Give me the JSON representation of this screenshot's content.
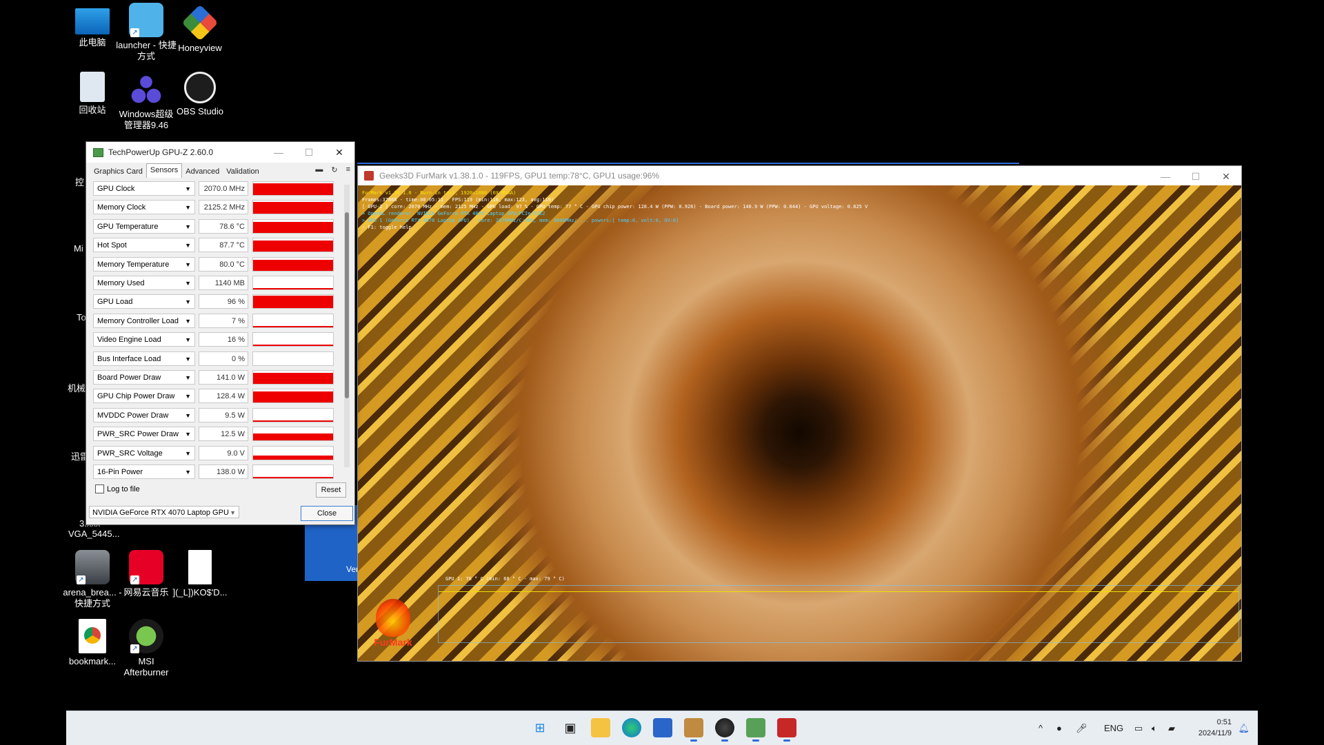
{
  "desktop": {
    "icons": [
      {
        "label": "此电脑"
      },
      {
        "label": "launcher - 快捷方式"
      },
      {
        "label": "Honeyview"
      },
      {
        "label": "回收站"
      },
      {
        "label": "Windows超级管理器9.46"
      },
      {
        "label": "OBS Studio"
      },
      {
        "label": "arena_brea... - 快捷方式"
      },
      {
        "label": "网易云音乐"
      },
      {
        "label": "](_L])KO$'D..."
      },
      {
        "label": "bookmark..."
      },
      {
        "label": "MSI Afterburner"
      }
    ],
    "partial_labels": [
      "控",
      "Mi",
      "To",
      "机械",
      "迅雷",
      "3.xxx",
      "VGA_5445...",
      "Ver"
    ]
  },
  "gpuz": {
    "title": "TechPowerUp GPU-Z 2.60.0",
    "tabs": [
      "Graphics Card",
      "Sensors",
      "Advanced",
      "Validation"
    ],
    "active_tab": "Sensors",
    "sensors": [
      {
        "name": "GPU Clock",
        "value": "2070.0 MHz",
        "level": 0.9
      },
      {
        "name": "Memory Clock",
        "value": "2125.2 MHz",
        "level": 0.9
      },
      {
        "name": "GPU Temperature",
        "value": "78.6 °C",
        "level": 0.85
      },
      {
        "name": "Hot Spot",
        "value": "87.7 °C",
        "level": 0.85
      },
      {
        "name": "Memory Temperature",
        "value": "80.0 °C",
        "level": 0.85
      },
      {
        "name": "Memory Used",
        "value": "1140 MB",
        "level": 0.1
      },
      {
        "name": "GPU Load",
        "value": "96 %",
        "level": 0.96
      },
      {
        "name": "Memory Controller Load",
        "value": "7 %",
        "level": 0.07
      },
      {
        "name": "Video Engine Load",
        "value": "16 %",
        "level": 0.1
      },
      {
        "name": "Bus Interface Load",
        "value": "0 %",
        "level": 0.0
      },
      {
        "name": "Board Power Draw",
        "value": "141.0 W",
        "level": 0.85
      },
      {
        "name": "GPU Chip Power Draw",
        "value": "128.4 W",
        "level": 0.85
      },
      {
        "name": "MVDDC Power Draw",
        "value": "9.5 W",
        "level": 0.1
      },
      {
        "name": "PWR_SRC Power Draw",
        "value": "12.5 W",
        "level": 0.5
      },
      {
        "name": "PWR_SRC Voltage",
        "value": "9.0 V",
        "level": 0.3
      },
      {
        "name": "16-Pin Power",
        "value": "138.0 W",
        "level": 0.1
      }
    ],
    "log_to_file": "Log to file",
    "reset": "Reset",
    "gpu_select": "NVIDIA GeForce RTX 4070 Laptop GPU",
    "close": "Close"
  },
  "furmark": {
    "title": "Geeks3D FurMark v1.38.1.0 - 119FPS, GPU1 temp:78°C, GPU1 usage:96%",
    "osd": {
      "line1": "FurMark v1.38.1.0 - Burn-in test, 1920x1080 (0X MSAA)",
      "line2": "Frames:37868 - time:00:05:11 - FPS:119 (min:116, max:123, avg:119)",
      "line3": "[ GPU-Z ] core: 2070 MHz - mem: 2125 MHz - GPU load: 97 % - GPU temp: 77 ° C - GPU chip power: 128.4 W (PPW: 0.926) - Board power: 140.9 W (PPW: 0.844) - GPU voltage: 0.825 V",
      "line4": "> OpenGL renderer: NVIDIA GeForce RTX 4070 Laptop GPU/PCIe/SSE2",
      "line5": "> GPU 1 (GeForce RTX 4070 Laptop GPU) - core: 2070MHz/C:98%, mem: 8008MHz/ ... powers:[ temp:0, volt:0, OV:0]",
      "line6": "- F1: toggle help"
    },
    "graph_label": "GPU 1: 78 ° C (min: 68 ° C - max: 79 ° C)",
    "logo_text": "FurMark"
  },
  "taskbar": {
    "icons": [
      "windows-start",
      "task-view",
      "file-explorer",
      "edge",
      "store",
      "app-1",
      "app-2",
      "gpu-z",
      "furmark"
    ],
    "tray": {
      "language": "ENG",
      "time": "0:51",
      "date": "2024/11/9"
    }
  },
  "colors": {
    "graph_red": "#ee0000",
    "taskbar_bg": "#e8edf2",
    "accent": "#2f6bd6"
  }
}
